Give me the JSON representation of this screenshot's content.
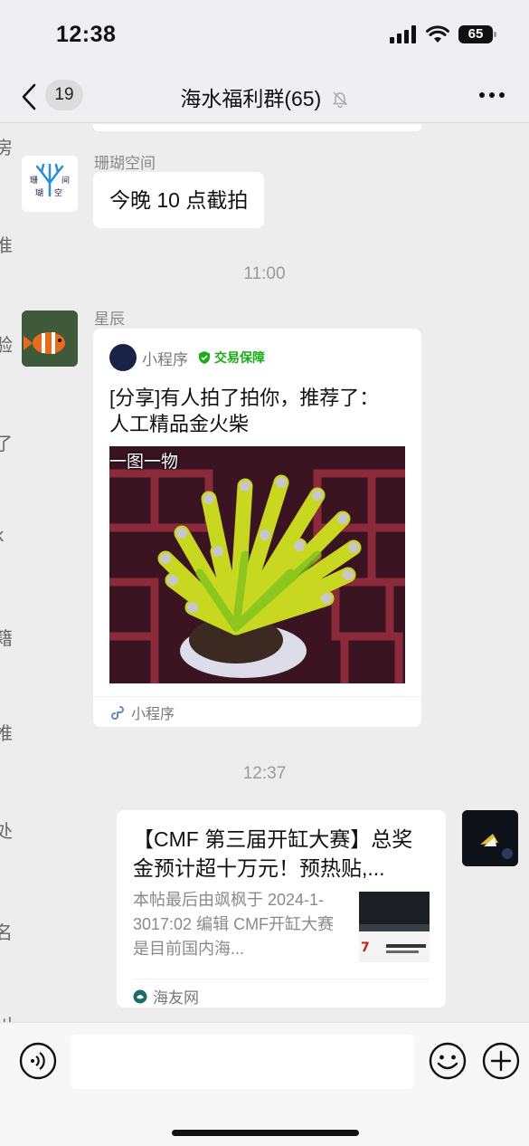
{
  "status_bar": {
    "time": "12:38",
    "battery": "65"
  },
  "nav": {
    "unread_count": "19",
    "title": "海水福利群(65)"
  },
  "time_dividers": [
    "11:00",
    "12:37"
  ],
  "messages": [
    {
      "sender": "珊瑚空间",
      "avatar_text": "珊 瑚 间 空",
      "text": "今晚 10 点截拍"
    },
    {
      "sender": "星辰",
      "mini_program": {
        "header_label": "小程序",
        "badge": "交易保障",
        "title": "[分享]有人拍了拍你，推荐了：人工精品金火柴",
        "image_caption": "一图一物",
        "footer_label": "小程序"
      }
    },
    {
      "self": true,
      "link": {
        "title": "【CMF 第三届开缸大赛】总奖金预计超十万元！预热贴,...",
        "description": "本帖最后由飒枫于 2024-1-3017:02 编辑 CMF开缸大赛是目前国内海...",
        "source": "海友网"
      }
    }
  ],
  "left_edge_glyphs": [
    "房",
    "准",
    "验",
    "了",
    "k",
    "籍",
    "推",
    "处",
    "名",
    "刂"
  ],
  "colors": {
    "accent_green": "#1aad19",
    "bubble": "#ffffff",
    "background": "#ededed"
  }
}
